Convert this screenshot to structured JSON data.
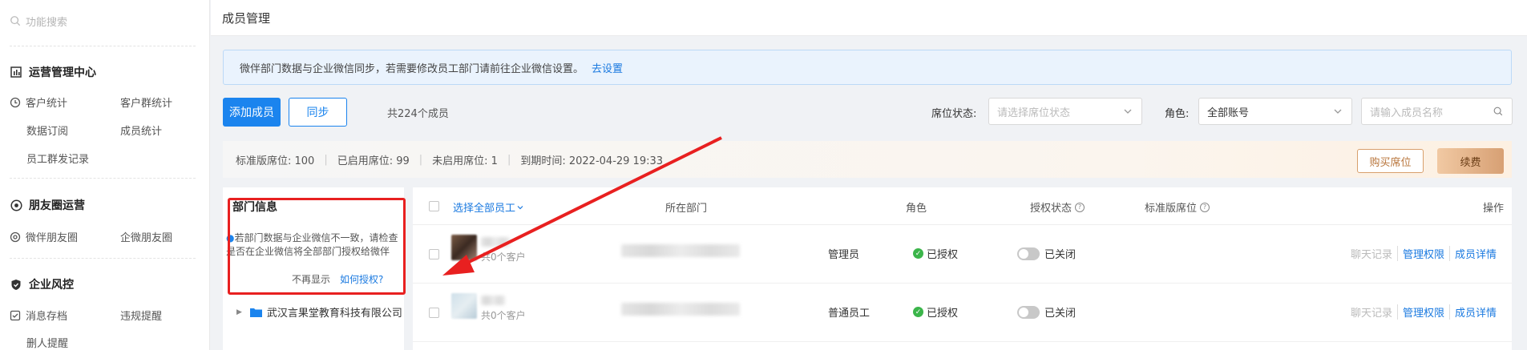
{
  "sidebar": {
    "search_placeholder": "功能搜索",
    "sections": [
      {
        "title": "运营管理中心",
        "icon": "chart-icon"
      },
      {
        "title": "朋友圈运营",
        "icon": "aperture-icon"
      },
      {
        "title": "企业风控",
        "icon": "shield-icon"
      }
    ],
    "items": {
      "customer_stats": "客户统计",
      "group_stats": "客户群统计",
      "data_subscription": "数据订阅",
      "member_stats": "成员统计",
      "group_send_records": "员工群发记录",
      "wechat_moments": "微伴朋友圈",
      "enterprise_moments": "企微朋友圈",
      "message_archive": "消息存档",
      "violation_alerts": "违规提醒",
      "delete_alerts": "删人提醒"
    }
  },
  "page": {
    "title": "成员管理"
  },
  "notice": {
    "text": "微伴部门数据与企业微信同步，若需要修改员工部门请前往企业微信设置。",
    "link": "去设置"
  },
  "toolbar": {
    "add_member": "添加成员",
    "sync": "同步",
    "member_count": "共224个成员",
    "seat_status_label": "席位状态:",
    "seat_status_placeholder": "请选择席位状态",
    "role_label": "角色:",
    "role_value": "全部账号",
    "name_search_placeholder": "请输入成员名称"
  },
  "seat_info": {
    "standard": "标准版席位: 100",
    "enabled": "已启用席位: 99",
    "unused": "未启用席位: 1",
    "expire": "到期时间: 2022-04-29 19:33",
    "buy": "购买席位",
    "renew": "续费"
  },
  "dept": {
    "title": "部门信息",
    "warning": "若部门数据与企业微信不一致，请检查是否在企业微信将全部部门授权给微伴",
    "dismiss": "不再显示",
    "how_to_auth": "如何授权?",
    "org_name": "武汉言果堂教育科技有限公司"
  },
  "table": {
    "headers": {
      "select_all": "选择全部员工",
      "department": "所在部门",
      "role": "角色",
      "auth_status": "授权状态",
      "seat": "标准版席位",
      "actions": "操作"
    },
    "rows": [
      {
        "customers": "共0个客户",
        "role": "管理员",
        "auth": "已授权",
        "seat": "已关闭",
        "op_chat": "聊天记录",
        "op_perm": "管理权限",
        "op_detail": "成员详情"
      },
      {
        "customers": "共0个客户",
        "role": "普通员工",
        "auth": "已授权",
        "seat": "已关闭",
        "op_chat": "聊天记录",
        "op_perm": "管理权限",
        "op_detail": "成员详情"
      }
    ]
  },
  "colors": {
    "primary": "#1b84ee",
    "annotation": "#e82020",
    "success": "#3bb54a"
  }
}
